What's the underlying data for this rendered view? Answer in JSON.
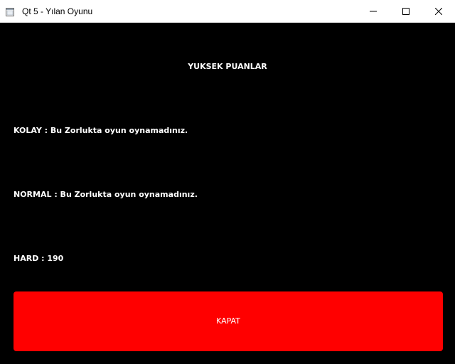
{
  "window": {
    "title": "Qt 5 - Yılan Oyunu"
  },
  "scores": {
    "heading": "YUKSEK PUANLAR",
    "lines": [
      "KOLAY : Bu Zorlukta oyun oynamadınız.",
      "NORMAL : Bu Zorlukta oyun oynamadınız.",
      "HARD : 190"
    ]
  },
  "actions": {
    "close_label": "KAPAT"
  },
  "colors": {
    "background": "#000000",
    "text": "#ffffff",
    "close_button": "#ff0000"
  },
  "icons": [
    "app-window-icon",
    "minimize-icon",
    "maximize-icon",
    "close-icon"
  ]
}
